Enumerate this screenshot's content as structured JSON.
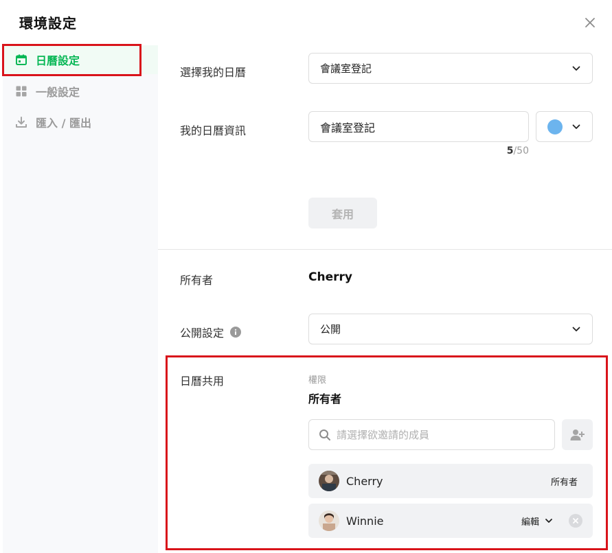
{
  "modal": {
    "title": "環境設定"
  },
  "sidebar": {
    "items": [
      {
        "label": "日曆設定",
        "icon": "calendar-icon",
        "active": true
      },
      {
        "label": "一般設定",
        "icon": "grid-icon",
        "active": false
      },
      {
        "label": "匯入 / 匯出",
        "icon": "download-icon",
        "active": false
      }
    ]
  },
  "calendar_settings": {
    "select_calendar_label": "選擇我的日曆",
    "select_calendar_value": "會議室登記",
    "calendar_info_label": "我的日曆資訊",
    "calendar_name_value": "會議室登記",
    "name_char_count": "5",
    "name_char_max": "/50",
    "calendar_color": "#6cb4ee",
    "apply_label": "套用"
  },
  "ownership": {
    "owner_label": "所有者",
    "owner_value": "Cherry",
    "visibility_label": "公開設定",
    "visibility_value": "公開"
  },
  "sharing": {
    "label": "日曆共用",
    "permission_caption": "權限",
    "permission_value": "所有者",
    "search_placeholder": "請選擇欲邀請的成員",
    "members": [
      {
        "name": "Cherry",
        "role": "所有者"
      },
      {
        "name": "Winnie",
        "role": "編輯"
      }
    ]
  },
  "colors": {
    "accent": "#06b755",
    "highlight": "#d9131a"
  }
}
